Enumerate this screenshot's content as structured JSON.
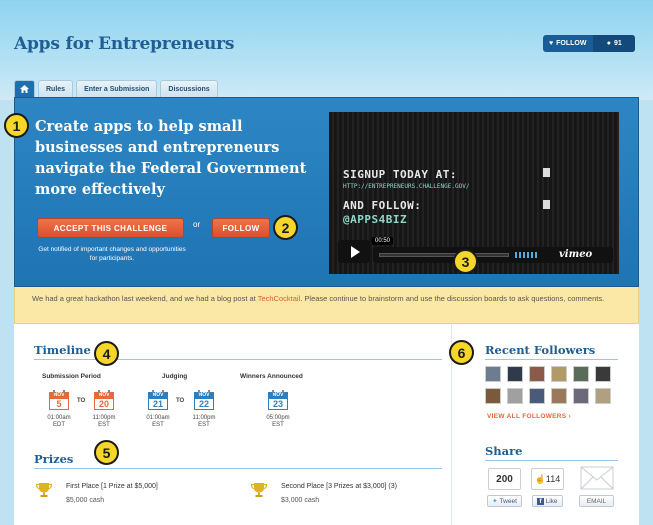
{
  "page": {
    "title": "Apps for Entrepreneurs"
  },
  "header": {
    "follow_label": "FOLLOW",
    "follower_count": "91"
  },
  "tabs": [
    {
      "label": "",
      "icon": "home-icon"
    },
    {
      "label": "Rules"
    },
    {
      "label": "Enter a Submission"
    },
    {
      "label": "Discussions"
    }
  ],
  "hero": {
    "headline": "Create apps to help small businesses and entrepreneurs navigate the Federal Government more effectively",
    "accept_label": "ACCEPT THIS CHALLENGE",
    "or_label": "or",
    "follow_label": "FOLLOW",
    "notify_text": "Get notified of important changes and opportunities for participants."
  },
  "video": {
    "line1": "SIGNUP TODAY AT:",
    "line2": "HTTP://ENTREPRENEURS.CHALLENGE.GOV/",
    "line3": "AND FOLLOW:",
    "line4": "@APPS4BIZ",
    "timestamp": "00:50",
    "brand": "vimeo"
  },
  "callouts": [
    "1",
    "2",
    "3",
    "4",
    "5",
    "6"
  ],
  "notice": {
    "before": "We had a great hackathon last weekend, and we had a blog post at ",
    "link": "TechCocktail",
    "after": ". Please continue to brainstorm and use the discussion boards to ask questions, comments."
  },
  "timeline": {
    "heading": "Timeline",
    "phases": [
      {
        "label": "Submission Period"
      },
      {
        "label": "Judging"
      },
      {
        "label": "Winners Announced"
      }
    ],
    "dates": [
      {
        "month": "NOV",
        "day": "5",
        "time": "01:00am",
        "tz": "EDT",
        "color": "#e8673b"
      },
      {
        "month": "NOV",
        "day": "20",
        "time": "11:00pm",
        "tz": "EST",
        "color": "#e8673b"
      },
      {
        "month": "NOV",
        "day": "21",
        "time": "01:00am",
        "tz": "EST",
        "color": "#2e7fbf"
      },
      {
        "month": "NOV",
        "day": "22",
        "time": "11:00pm",
        "tz": "EST",
        "color": "#2e7fbf"
      },
      {
        "month": "NOV",
        "day": "23",
        "time": "05:00pm",
        "tz": "EST",
        "color": "#2e7fbf"
      }
    ],
    "to_label": "TO"
  },
  "prizes": {
    "heading": "Prizes",
    "items": [
      {
        "title": "First Place [1 Prize at $5,000]",
        "cash": "$5,000 cash"
      },
      {
        "title": "Second Place [3 Prizes at $3,000] (3)",
        "cash": "$3,000 cash"
      }
    ]
  },
  "followers": {
    "heading": "Recent Followers",
    "view_all": "VIEW ALL FOLLOWERS ›",
    "avatar_colors": [
      "#6b7d8f",
      "#2f3a4a",
      "#8a5a4a",
      "#b09a6a",
      "#5a6b5a",
      "#3a3a3a",
      "#7a5a3a",
      "#a0a0a0",
      "#4a5a7a",
      "#9a7a5a",
      "#6a6a7a",
      "#b0a080"
    ]
  },
  "share": {
    "heading": "Share",
    "tweet_count": "200",
    "like_count": "114",
    "tweet_label": "Tweet",
    "like_label": "Like",
    "email_label": "EMAIL"
  },
  "colors": {
    "brand_blue": "#1f74b3",
    "accent_orange": "#e8673b",
    "notice_bg": "#fce8a6"
  }
}
